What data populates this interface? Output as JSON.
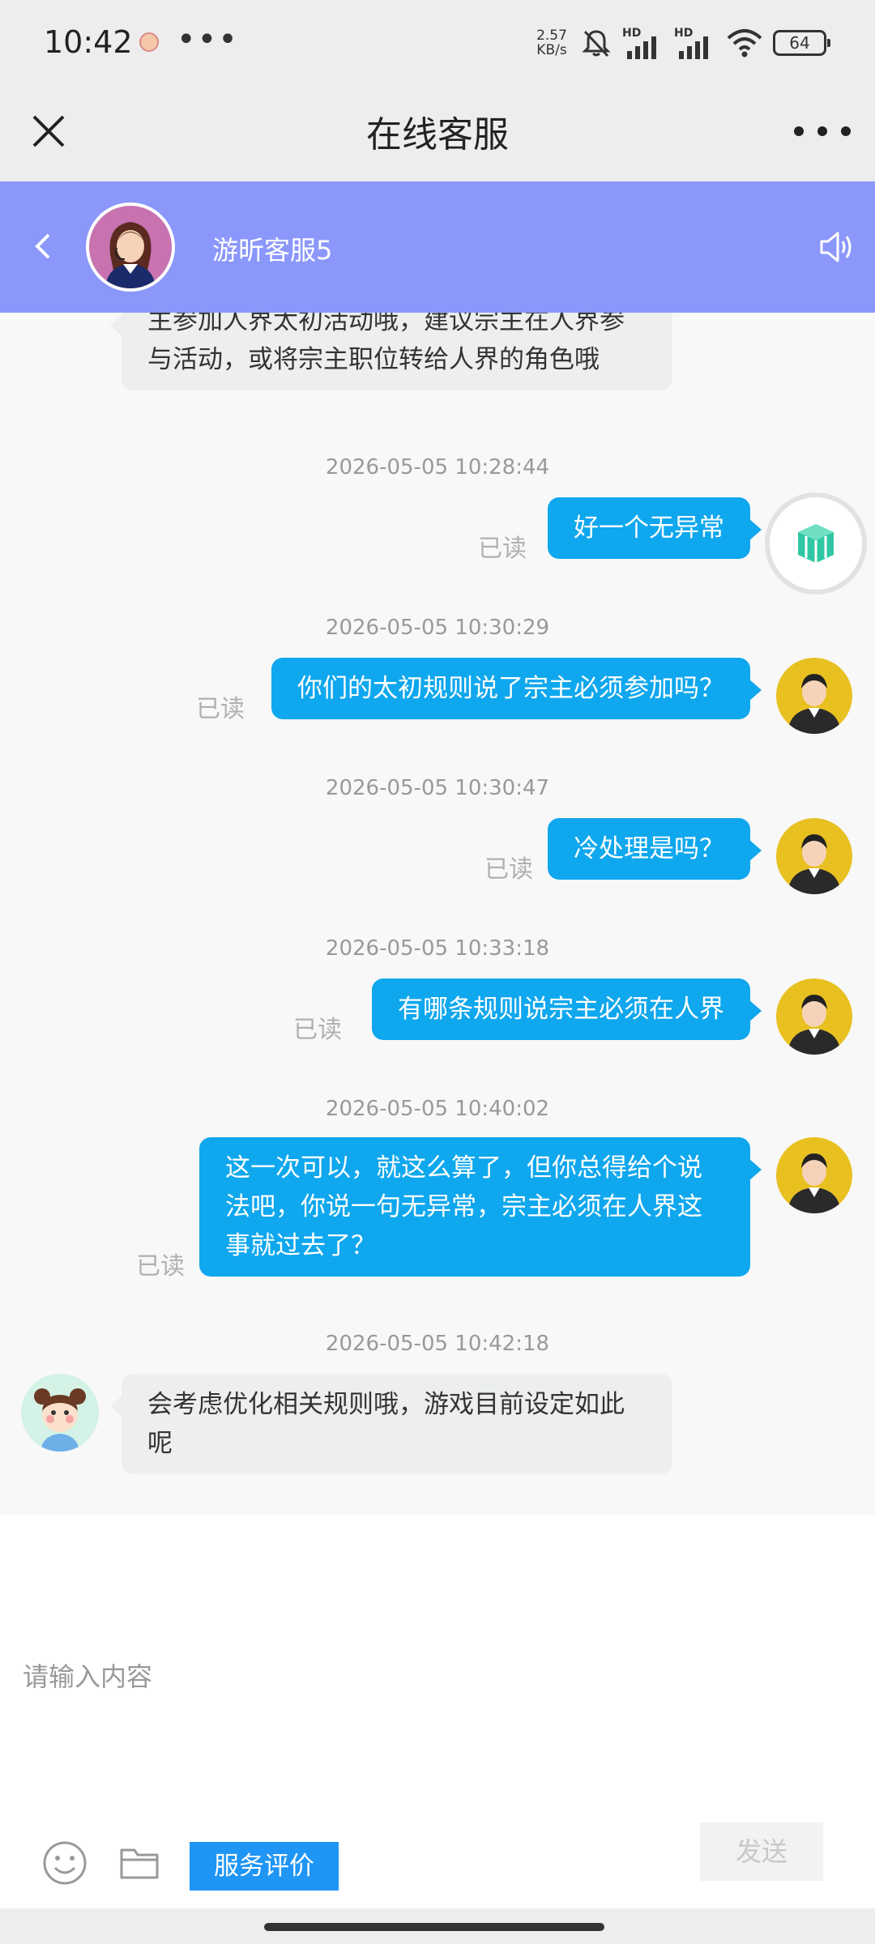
{
  "status_bar": {
    "time": "10:42",
    "dots": "•••",
    "net_speed_value": "2.57",
    "net_speed_unit": "KB/s",
    "sim1_label": "HD",
    "sim2_label": "HD",
    "battery": "64"
  },
  "title_bar": {
    "title": "在线客服"
  },
  "agent": {
    "name": "游昕客服5"
  },
  "chat": {
    "partial_message": {
      "line1": "主参加人界太初活动哦，建议宗主在人界参",
      "line2": "与活动，或将宗主职位转给人界的角色哦"
    },
    "messages": [
      {
        "timestamp": "2026-05-05 10:28:44",
        "text": "好一个无异常",
        "status": "已读",
        "sender": "user"
      },
      {
        "timestamp": "2026-05-05 10:30:29",
        "text": "你们的太初规则说了宗主必须参加吗？",
        "status": "已读",
        "sender": "user"
      },
      {
        "timestamp": "2026-05-05 10:30:47",
        "text": "冷处理是吗？",
        "status": "已读",
        "sender": "user"
      },
      {
        "timestamp": "2026-05-05 10:33:18",
        "text": "有哪条规则说宗主必须在人界",
        "status": "已读",
        "sender": "user"
      },
      {
        "timestamp": "2026-05-05 10:40:02",
        "lines": [
          "这一次可以，就这么算了，但你总得给个说",
          "法吧，你说一句无异常，宗主必须在人界这",
          "事就过去了？"
        ],
        "status": "已读",
        "sender": "user"
      },
      {
        "timestamp": "2026-05-05 10:42:18",
        "lines": [
          "会考虑优化相关规则哦，游戏目前设定如此",
          "呢"
        ],
        "sender": "agent"
      }
    ]
  },
  "input": {
    "placeholder": "请输入内容",
    "rate_label": "服务评价",
    "send_label": "发送"
  },
  "colors": {
    "agent_bar": "#8b97fb",
    "user_bubble": "#0fa7ee",
    "agent_bubble": "#eceeef",
    "rate_button": "#1f95f5"
  },
  "icons": [
    "close-icon",
    "more-icon",
    "back-icon",
    "speaker-icon",
    "emoji-icon",
    "folder-icon",
    "cube-icon"
  ]
}
